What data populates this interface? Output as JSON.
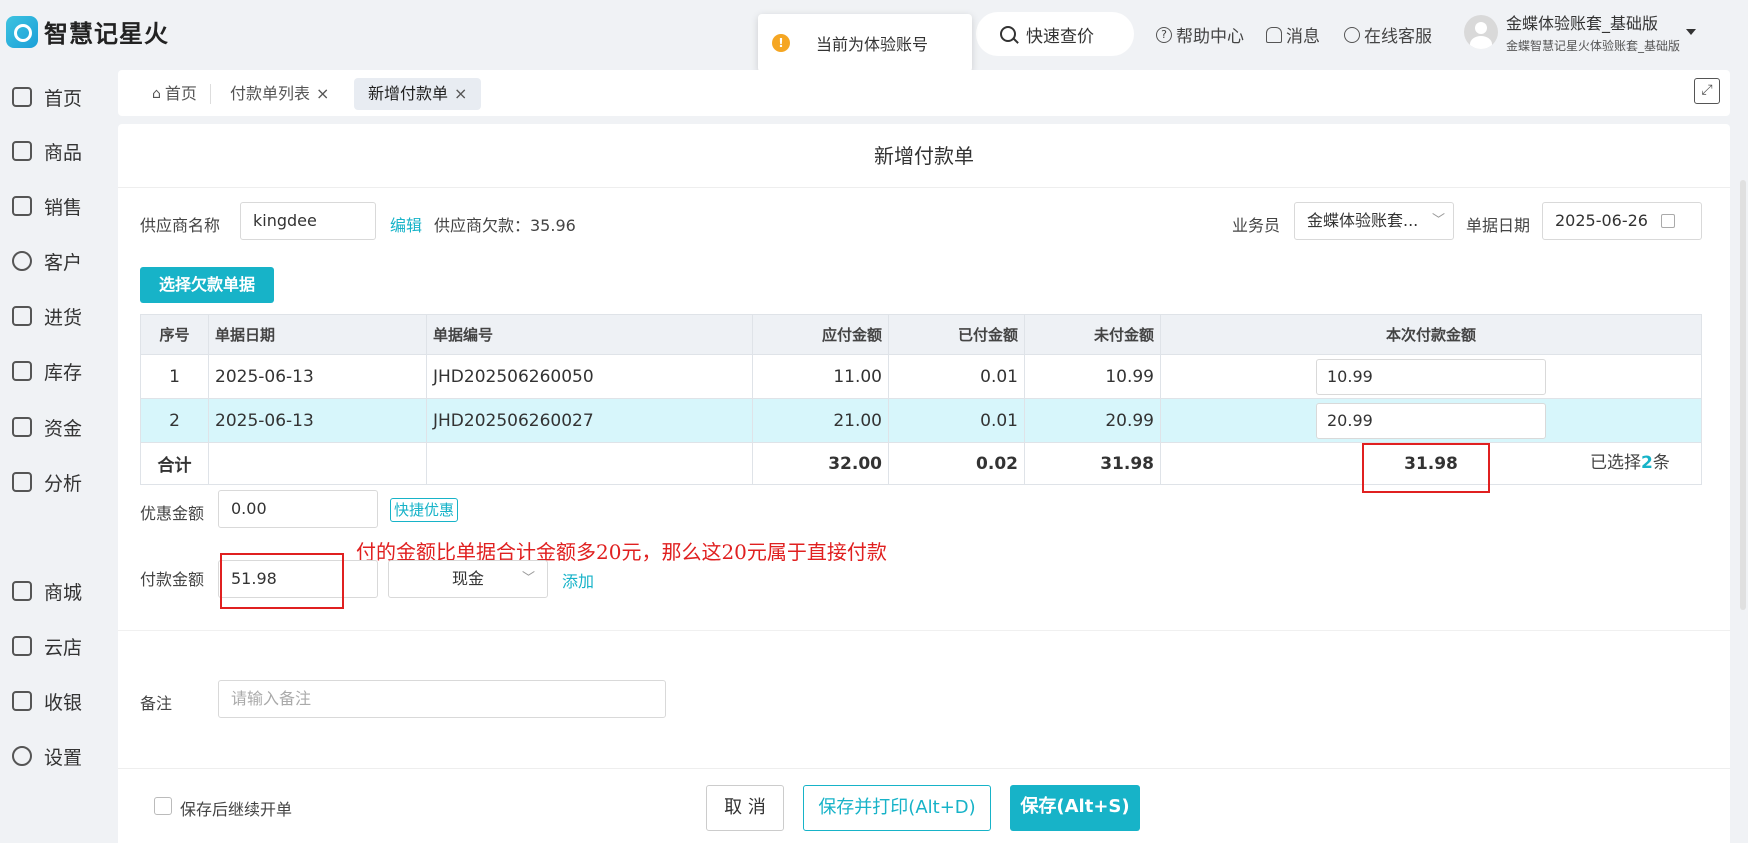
{
  "app": {
    "logo_text": "智慧记星火"
  },
  "toast": {
    "text": "当前为体验账号"
  },
  "header": {
    "quick_search": "快速查价",
    "help": "帮助中心",
    "messages": "消息",
    "online_service": "在线客服",
    "user_name": "金蝶体验账套_基础版",
    "user_sub": "金蝶智慧记星火体验账套_基础版"
  },
  "sidebar": {
    "items": [
      {
        "label": "首页"
      },
      {
        "label": "商品"
      },
      {
        "label": "销售"
      },
      {
        "label": "客户"
      },
      {
        "label": "进货"
      },
      {
        "label": "库存"
      },
      {
        "label": "资金"
      },
      {
        "label": "分析"
      },
      {
        "label": "商城"
      },
      {
        "label": "云店"
      },
      {
        "label": "收银"
      },
      {
        "label": "设置"
      }
    ]
  },
  "tabs": {
    "home": "首页",
    "list": "付款单列表",
    "new": "新增付款单"
  },
  "form": {
    "title": "新增付款单",
    "supplier_label": "供应商名称",
    "supplier_value": "kingdee",
    "edit_link": "编辑",
    "supplier_debt": "供应商欠款：35.96",
    "salesman_label": "业务员",
    "salesman_value": "金蝶体验账套...",
    "date_label": "单据日期",
    "date_value": "2025-06-26",
    "select_bills_button": "选择欠款单据",
    "selected_prefix": "已选择",
    "selected_count": "2",
    "selected_suffix": "条",
    "discount_label": "优惠金额",
    "discount_value": "0.00",
    "quick_discount": "快捷优惠",
    "payment_label": "付款金额",
    "payment_value": "51.98",
    "payment_method": "现金",
    "add_link": "添加",
    "remark_label": "备注",
    "remark_placeholder": "请输入备注"
  },
  "table": {
    "headers": [
      "序号",
      "单据日期",
      "单据编号",
      "应付金额",
      "已付金额",
      "未付金额",
      "本次付款金额"
    ],
    "rows": [
      {
        "idx": "1",
        "date": "2025-06-13",
        "no": "JHD202506260050",
        "payable": "11.00",
        "paid": "0.01",
        "unpaid": "10.99",
        "current": "10.99"
      },
      {
        "idx": "2",
        "date": "2025-06-13",
        "no": "JHD202506260027",
        "payable": "21.00",
        "paid": "0.01",
        "unpaid": "20.99",
        "current": "20.99"
      }
    ],
    "total": {
      "label": "合计",
      "payable": "32.00",
      "paid": "0.02",
      "unpaid": "31.98",
      "current": "31.98"
    }
  },
  "annotation": "付的金额比单据合计金额多20元，那么这20元属于直接付款",
  "footer": {
    "continue_label": "保存后继续开单",
    "cancel": "取 消",
    "save_print": "保存并打印(Alt+D)",
    "save": "保存(Alt+S)"
  },
  "colors": {
    "accent": "#17b3c8",
    "annotation": "#e02020",
    "selected_row": "#d7f6fb"
  }
}
